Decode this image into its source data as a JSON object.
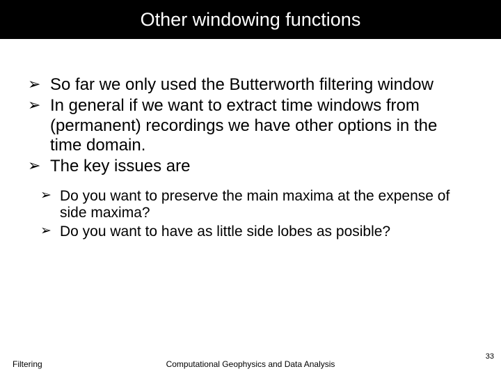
{
  "title": "Other windowing functions",
  "bullets": [
    "So far we only used the Butterworth filtering window",
    "In general if we want to extract time windows from (permanent) recordings we have other options in the time domain.",
    "The key issues are"
  ],
  "sub_bullets": [
    "Do you want to preserve the main maxima at the expense of side maxima?",
    "Do you want to have as little side lobes as posible?"
  ],
  "footer": {
    "left": "Filtering",
    "center": "Computational Geophysics and Data Analysis",
    "page": "33"
  }
}
